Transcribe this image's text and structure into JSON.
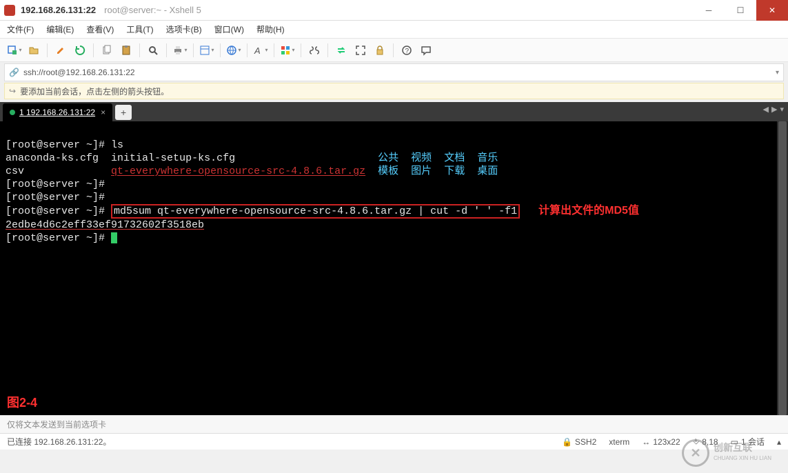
{
  "window": {
    "title_ip": "192.168.26.131:22",
    "title_rest": "root@server:~ - Xshell 5"
  },
  "menu": {
    "file": "文件(F)",
    "edit": "编辑(E)",
    "view": "查看(V)",
    "tools": "工具(T)",
    "tabs": "选项卡(B)",
    "window": "窗口(W)",
    "help": "帮助(H)"
  },
  "address": {
    "url": "ssh://root@192.168.26.131:22"
  },
  "hint": {
    "text": "要添加当前会话，点击左侧的箭头按钮。"
  },
  "tab": {
    "label": "1 192.168.26.131:22"
  },
  "terminal": {
    "prompt": "[root@server ~]# ",
    "cmd_ls": "ls",
    "row1_col1": "anaconda-ks.cfg",
    "row1_col2": "initial-setup-ks.cfg",
    "row2_col1": "csv",
    "row2_col2": "qt-everywhere-opensource-src-4.8.6.tar.gz",
    "dirs": {
      "a1": "公共",
      "a2": "视频",
      "a3": "文档",
      "a4": "音乐",
      "b1": "模板",
      "b2": "图片",
      "b3": "下载",
      "b4": "桌面"
    },
    "cmd_md5": "md5sum qt-everywhere-opensource-src-4.8.6.tar.gz | cut -d ' ' -f1",
    "md5_output": "2edbe4d6c2eff33ef91732602f3518eb",
    "annotation": "计算出文件的MD5值",
    "figlabel": "图2-4"
  },
  "inputhint": {
    "text": "仅将文本发送到当前选项卡"
  },
  "status": {
    "left": "已连接 192.168.26.131:22。",
    "ssh": "SSH2",
    "term": "xterm",
    "size": "123x22",
    "pos": "8,18",
    "sessions": "1 会话"
  },
  "watermark": {
    "brand1": "创新互联",
    "brand2": "CHUANG XIN HU LIAN"
  }
}
